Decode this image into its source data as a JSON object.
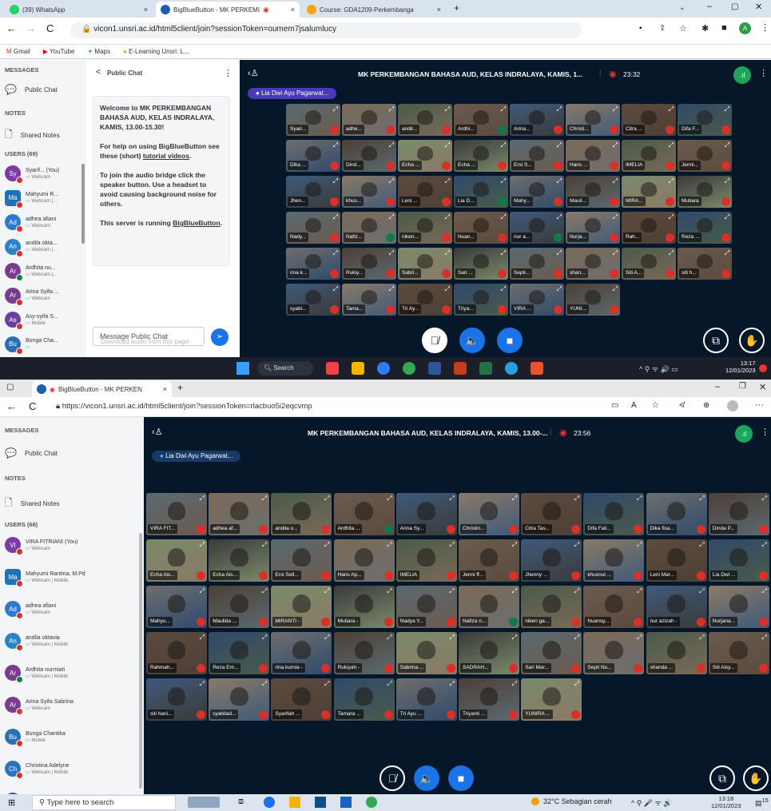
{
  "top": {
    "tabs": [
      {
        "label": "(39) WhatsApp",
        "close": "×"
      },
      {
        "label": "BigBlueButton - MK PERKEMI",
        "close": "×"
      },
      {
        "label": "Course: GDA1209-Perkembanga",
        "close": "×"
      }
    ],
    "new_tab": "+",
    "url": "vicon1.unsri.ac.id/html5client/join?sessionToken=oumem7jsalumlucy",
    "bookmarks": [
      "Gmail",
      "YouTube",
      "Maps",
      "E-Learning Unsri: L..."
    ],
    "sections": {
      "messages": "MESSAGES",
      "public_chat": "Public Chat",
      "notes": "NOTES",
      "shared_notes": "Shared Notes",
      "users": "USERS (69)"
    },
    "users": [
      {
        "initials": "Sy",
        "name": "Syarif... (You)",
        "status": "Webcam",
        "color": "#7b3aa8",
        "mic": "off"
      },
      {
        "initials": "Ma",
        "name": "Mahyumi R...",
        "status": "Webcam |...",
        "color": "#1d72b8",
        "mic": "off",
        "square": true
      },
      {
        "initials": "Ad",
        "name": "adhea afiani",
        "status": "Webcam",
        "color": "#2a7ad0",
        "mic": "off"
      },
      {
        "initials": "An",
        "name": "andila okta...",
        "status": "Webcam |...",
        "color": "#2b82c9",
        "mic": "off"
      },
      {
        "initials": "Ar",
        "name": "Ardhita nu...",
        "status": "Webcam |...",
        "color": "#7a3c8c",
        "mic": "on"
      },
      {
        "initials": "Ar",
        "name": "Arina Syifa ...",
        "status": "Webcam",
        "color": "#7a3c8c",
        "mic": "off"
      },
      {
        "initials": "As",
        "name": "Asy-syifa S...",
        "status": "Mobile",
        "color": "#6a3fa0",
        "mic": "off"
      },
      {
        "initials": "Bu",
        "name": "Bunga Cha...",
        "status": "",
        "color": "#2a6fb3",
        "mic": "off"
      }
    ],
    "chat": {
      "title": "Public Chat",
      "back": "<",
      "menu": "⋮",
      "welcome": "Welcome to MK PERKEMBANGAN BAHASA AUD, KELAS INDRALAYA, KAMIS, 13.00-15.30!",
      "help": "For help on using BigBlueButton see these (short)",
      "help_link": "tutorial videos",
      "audio": "To join the audio bridge click the speaker button. Use a headset to avoid causing background noise for others.",
      "server": "This server is running",
      "server_link": "BigBlueButton",
      "placeholder": "Message Public Chat",
      "download": "Download audio from this page"
    },
    "meeting_title": "MK PERKEMBANGAN BAHASA AUD, KELAS INDRALAYA, KAMIS, 1...",
    "timer": "23:32",
    "presenter": "Lia Dwi Ayu Pagarwat...",
    "tiles": [
      "Syari...",
      "adhe...",
      "andil...",
      "Ardhi...",
      "Arina...",
      "Christi...",
      "Citra ...",
      "Difa F...",
      "Dika ...",
      "Dind...",
      "Echa ...",
      "Echa ...",
      "Ersi S...",
      "Hans ...",
      "IMELIA",
      "Jenni...",
      "Jhen...",
      "khus...",
      "Leni ...",
      "Lia D...",
      "Mahy...",
      "Mauli...",
      "MIRA...",
      "Mutiara",
      "Nady...",
      "Nafiz...",
      "niken...",
      "Nuan...",
      "nur a...",
      "Nurja...",
      "Rah...",
      "Reza ...",
      "rina k...",
      "Rukiy...",
      "Sabri...",
      "Sari ...",
      "Septi...",
      "shan...",
      "Siti A...",
      "siti h...",
      "syabi...",
      "Tama...",
      "Tri Ay...",
      "Triya...",
      "VIRA ...",
      "YUNI..."
    ],
    "taskbar": {
      "search": "Search",
      "time": "13:17",
      "date": "12/01/2023"
    }
  },
  "bottom": {
    "tab": "BigBlueButton - MK PERKEN",
    "tab_close": "×",
    "new_tab": "+",
    "url": "https://vicon1.unsri.ac.id/html5client/join?sessionToken=rlacbuo5i2eqcvmp",
    "sections": {
      "messages": "MESSAGES",
      "public_chat": "Public Chat",
      "notes": "NOTES",
      "shared_notes": "Shared Notes",
      "users": "USERS (68)"
    },
    "users": [
      {
        "initials": "VI",
        "name": "VIRA FITRIANI (You)",
        "status": "Webcam",
        "color": "#7b3aa8",
        "mic": "off"
      },
      {
        "initials": "Ma",
        "name": "Mahyumi Rantina, M.Pd",
        "status": "Webcam | Mobile",
        "color": "#1d72b8",
        "mic": "off",
        "square": true
      },
      {
        "initials": "Ad",
        "name": "adhea afiani",
        "status": "Webcam",
        "color": "#2a7ad0",
        "mic": "off"
      },
      {
        "initials": "An",
        "name": "andila oktavia",
        "status": "Webcam | Mobile",
        "color": "#2b82c9",
        "mic": "off"
      },
      {
        "initials": "Ar",
        "name": "Ardhita nurmiati",
        "status": "Webcam | Mobile",
        "color": "#7a3c8c",
        "mic": "on"
      },
      {
        "initials": "Ar",
        "name": "Arina Syifa Sabrina",
        "status": "Webcam",
        "color": "#7a3c8c",
        "mic": "off"
      },
      {
        "initials": "Bu",
        "name": "Bunga Chantika",
        "status": "Mobile",
        "color": "#2a6fb3",
        "mic": "off"
      },
      {
        "initials": "Ch",
        "name": "Christina Adelyne",
        "status": "Webcam | Mobile",
        "color": "#2b72c0",
        "mic": "off"
      },
      {
        "initials": "CI",
        "name": "citra tasya abelia",
        "status": "",
        "color": "#7b2a9a",
        "mic": "off"
      }
    ],
    "meeting_title": "MK PERKEMBANGAN BAHASA AUD, KELAS INDRALAYA, KAMIS, 13.00-...",
    "timer": "23:56",
    "presenter": "Lia Dwi Ayu Pagarwat...",
    "tiles": [
      "VIRA FIT...",
      "adhea af...",
      "andila o...",
      "Ardhita ...",
      "Arina Sy...",
      "Christin...",
      "Citra Tas...",
      "Difa Fali...",
      "Dika fisa...",
      "Dinda P...",
      "Echa Ais...",
      "Echa Ais...",
      "Ersi Sell...",
      "Hans Ap...",
      "IMELIA",
      "Jenni ff...",
      "Jhenny ...",
      "khusnul ...",
      "Leni Mar...",
      "Lia Dwi ...",
      "Mahyu...",
      "Maulida ...",
      "MIRANTI -",
      "Mutiara -",
      "Nadya Y...",
      "Nafiza n...",
      "niken ga...",
      "Nuansy...",
      "nur azizah -",
      "Nurjana...",
      "Rahmah...",
      "Reza Em...",
      "rina kurnia -",
      "Rukiyah -",
      "Sabrina ...",
      "SADRAH...",
      "Sari Mar...",
      "Septi Nu...",
      "shanda ...",
      "Siti Aisy...",
      "siti hani...",
      "syabilad...",
      "Syarifah ...",
      "Tamara ...",
      "Tri Ayu ...",
      "Triyanti ...",
      "YUNIRA ..."
    ],
    "taskbar": {
      "search": "Type here to search",
      "weather": "32°C Sebagian cerah",
      "time": "13:18",
      "date": "12/01/2023",
      "badge": "15"
    }
  }
}
